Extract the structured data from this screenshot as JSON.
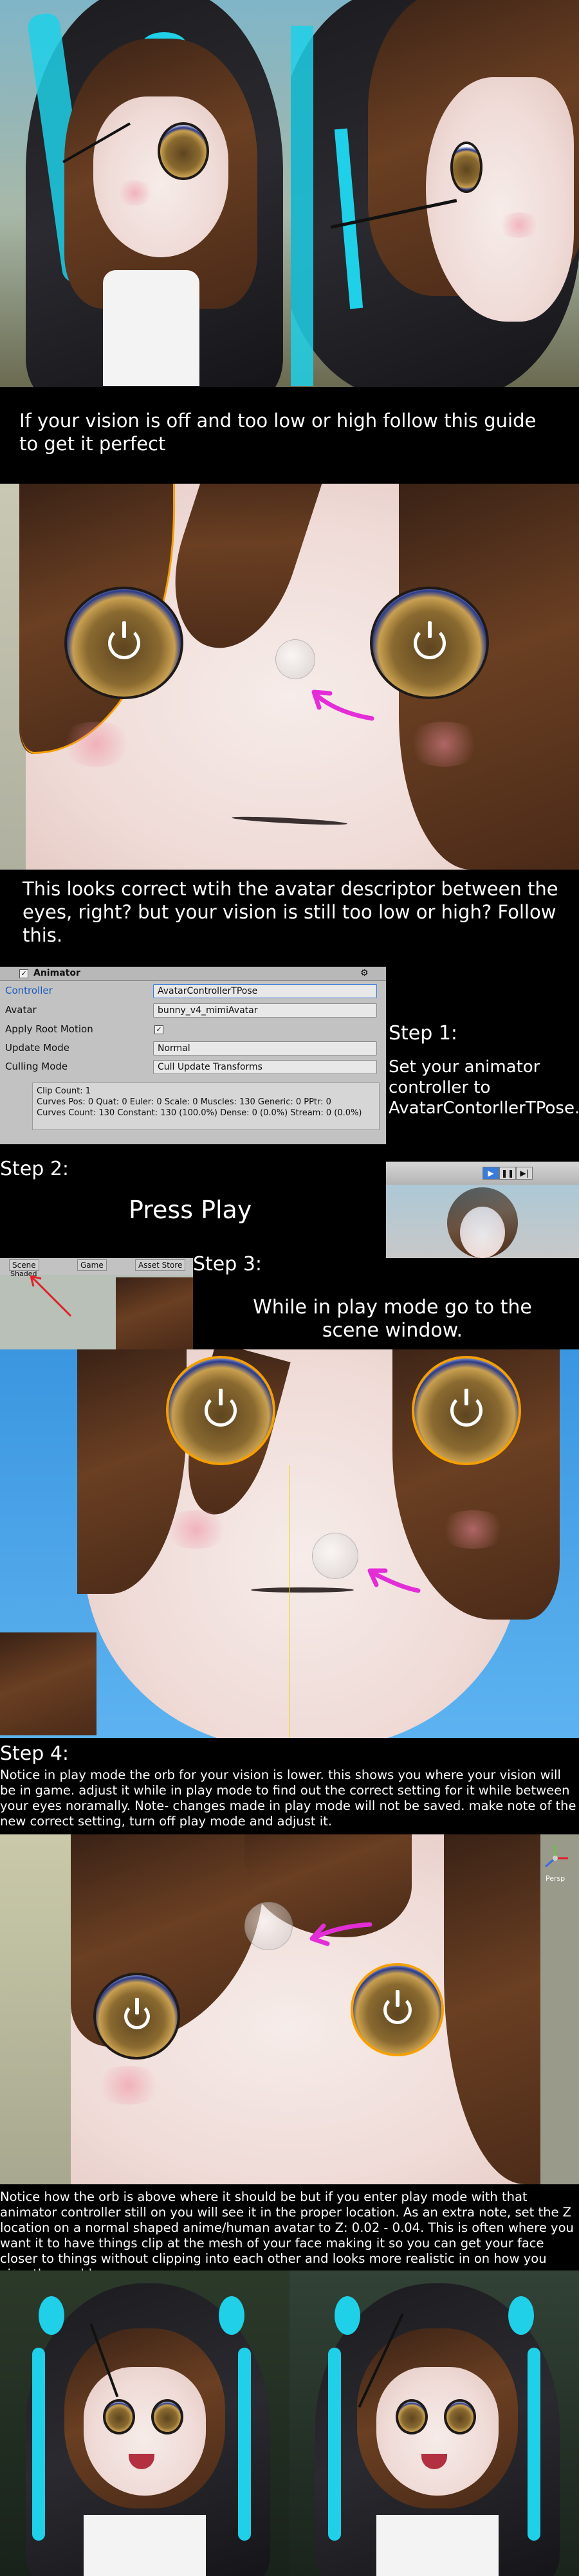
{
  "intro": {
    "text": "If your vision is off and too low or high follow this guide to get it perfect"
  },
  "panel2": {
    "text": "This looks correct wtih the avatar descriptor between the eyes, right? but your vision is still too low or high? Follow this."
  },
  "inspector": {
    "component": "Animator",
    "controller_label": "Controller",
    "controller_value": "AvatarControllerTPose",
    "avatar_label": "Avatar",
    "avatar_value": "bunny_v4_mimiAvatar",
    "root_motion_label": "Apply Root Motion",
    "update_mode_label": "Update Mode",
    "update_mode_value": "Normal",
    "culling_mode_label": "Culling Mode",
    "culling_mode_value": "Cull Update Transforms",
    "clip_count": "Clip Count: 1",
    "curves_pos": "Curves Pos: 0 Quat: 0 Euler: 0 Scale: 0 Muscles: 130 Generic: 0 PPtr: 0",
    "curves_count": "Curves Count: 130 Constant: 130 (100.0%) Dense: 0 (0.0%) Stream: 0 (0.0%)"
  },
  "step1": {
    "title": "Step 1:",
    "text": "Set your animator controller to AvatarContorllerTPose."
  },
  "step2": {
    "title": "Step 2:",
    "text": "Press Play"
  },
  "step3": {
    "title": "Step 3:",
    "text": "While in play mode go to the scene window.",
    "tabs": [
      "Scene",
      "Game",
      "Asset Store"
    ],
    "shaded": "Shaded"
  },
  "step4": {
    "title": "Step 4:",
    "text": "Notice in play mode the orb for your vision is lower. this shows you where your vision will be in game. adjust it while in play mode to find out the correct setting for it while between your eyes noramally. Note- changes made in play mode will not be saved. make note of the new correct setting, turn off play mode and adjust it."
  },
  "final": {
    "text": "Notice how the orb is above where it should be but if you enter play mode with that animator controller still on you will see it in the proper location. As an extra note, set the Z location on a normal shaped anime/human avatar to Z: 0.02 - 0.04. This is often where you want it to have things clip at the mesh of your face making it so you can get your face closer to things without clipping into each other and looks more realistic in on how you view the world.",
    "persp": "Persp"
  },
  "colors": {
    "accent_magenta": "#e32ed8",
    "hood_cyan": "#1fd0e8",
    "orange_outline": "#f5a000",
    "background": "#000000"
  }
}
